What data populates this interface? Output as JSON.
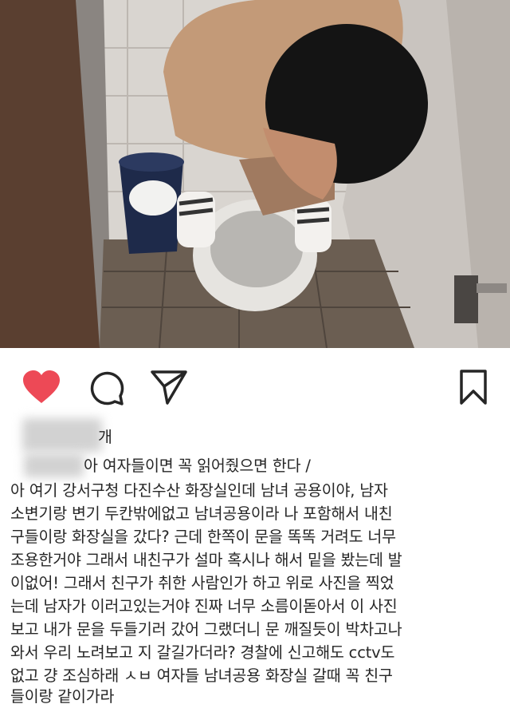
{
  "post": {
    "photo_alt": "",
    "actions": {
      "like_icon": "heart-icon",
      "comment_icon": "comment-icon",
      "share_icon": "paper-plane-icon",
      "save_icon": "bookmark-icon",
      "like_color": "#ed4956"
    },
    "likes_suffix": "개",
    "caption_first_line": "아 여자들이면 꼭 읽어줬으면 한다 /",
    "caption_lines": [
      "아 여기 강서구청 다진수산 화장실인데 남녀 공용이야, 남자",
      "소변기랑 변기 두칸밖에없고 남녀공용이라 나 포함해서 내친",
      "구들이랑 화장실을 갔다? 근데 한쪽이 문을 똑똑 거려도 너무",
      "조용한거야 그래서 내친구가 설마 혹시나 해서 밑을 봤는데 발",
      "이없어! 그래서 친구가 취한 사람인가 하고 위로 사진을  찍었",
      "는데 남자가 이러고있는거야 진짜 너무 소름이돋아서 이 사진",
      "보고 내가 문을 두들기러 갔어 그랬더니 문 깨질듯이 박차고나",
      "와서 우리 노려보고 지 갈길가더라? 경찰에 신고해도 cctv도",
      "없고 걍 조심하래 ㅅㅂ 여자들 남녀공용 화장실 갈때 꼭  친구",
      "들이랑 같이가라"
    ]
  }
}
